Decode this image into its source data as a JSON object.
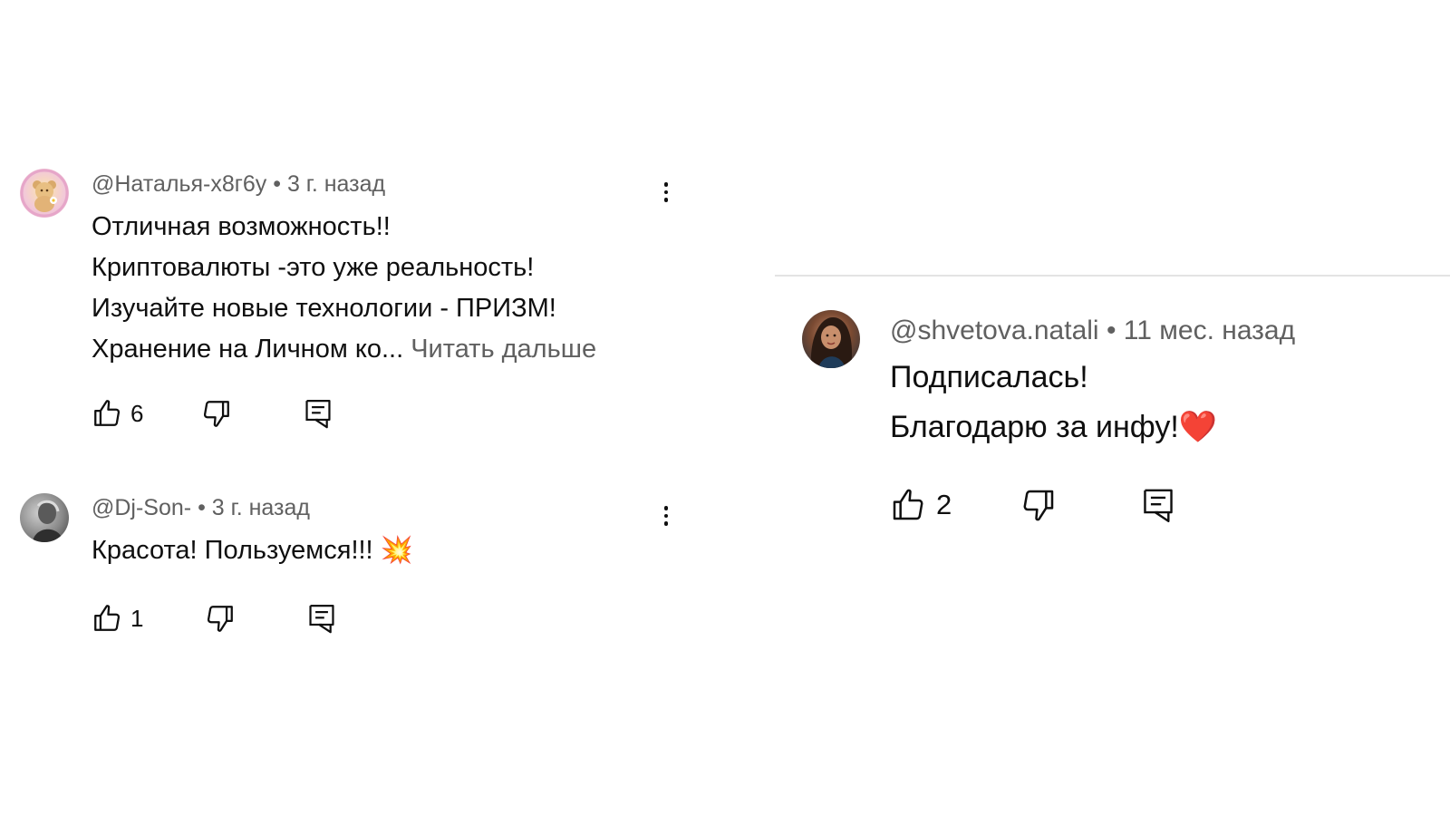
{
  "comments": [
    {
      "author": "@Наталья-x8г6у",
      "sep": "•",
      "time": "3 г. назад",
      "lines": [
        "Отличная возможность!!",
        "Криптовалюты -это уже реальность!",
        "Изучайте новые технологии - ПРИЗМ!",
        "Хранение на Личном ко..."
      ],
      "read_more": "Читать дальше",
      "likes": "6",
      "avatar_icon": "teddy-bear-avatar"
    },
    {
      "author": "@Dj-Son-",
      "sep": "•",
      "time": "3 г. назад",
      "lines": [
        "Красота! Пользуемся!!! 💥"
      ],
      "likes": "1",
      "avatar_icon": "grey-portrait-avatar"
    },
    {
      "author": "@shvetova.natali",
      "sep": "•",
      "time": "11 мес. назад",
      "lines": [
        "Подписалась!",
        "Благодарю за инфу!❤️"
      ],
      "likes": "2",
      "avatar_icon": "woman-portrait-avatar"
    }
  ],
  "colors": {
    "text": "#0f0f0f",
    "meta": "#606060",
    "divider": "#e3e3e3"
  },
  "icons": [
    "like-icon",
    "dislike-icon",
    "reply-icon",
    "more-vert-icon"
  ]
}
